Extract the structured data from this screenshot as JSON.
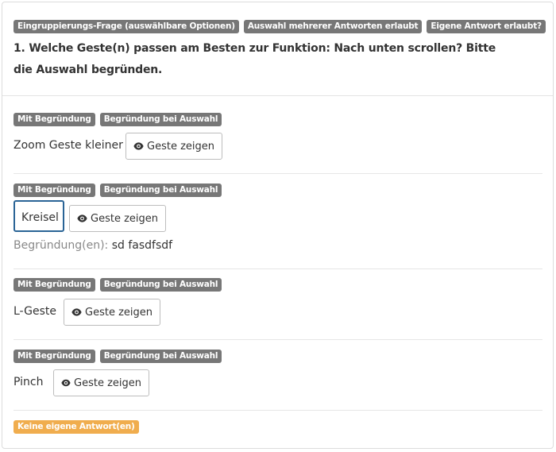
{
  "header": {
    "badges": [
      "Eingruppierungs-Frage (auswählbare Optionen)",
      "Auswahl mehrerer Antworten erlaubt",
      "Eigene Antwort erlaubt?"
    ],
    "question": "1. Welche Geste(n) passen am Besten zur Funktion: Nach unten scrollen? Bitte die Auswahl begründen."
  },
  "options": [
    {
      "badges": [
        "Mit Begründung",
        "Begründung bei Auswahl"
      ],
      "label": "Zoom Geste kleiner",
      "button": "Geste zeigen",
      "selected": false
    },
    {
      "badges": [
        "Mit Begründung",
        "Begründung bei Auswahl"
      ],
      "label": "Kreisel",
      "button": "Geste zeigen",
      "selected": true,
      "reason_label": "Begründung(en):",
      "reason_value": "sd fasdfsdf"
    },
    {
      "badges": [
        "Mit Begründung",
        "Begründung bei Auswahl"
      ],
      "label": "L-Geste",
      "button": "Geste zeigen",
      "selected": false
    },
    {
      "badges": [
        "Mit Begründung",
        "Begründung bei Auswahl"
      ],
      "label": "Pinch",
      "button": "Geste zeigen",
      "selected": false
    }
  ],
  "footer": {
    "badge": "Keine eigene Antwort(en)"
  },
  "colors": {
    "badge_gray": "#777777",
    "badge_orange": "#f0ad4e",
    "selected_border": "#2a6496"
  },
  "icons": {
    "button_icon": "eye-icon"
  }
}
